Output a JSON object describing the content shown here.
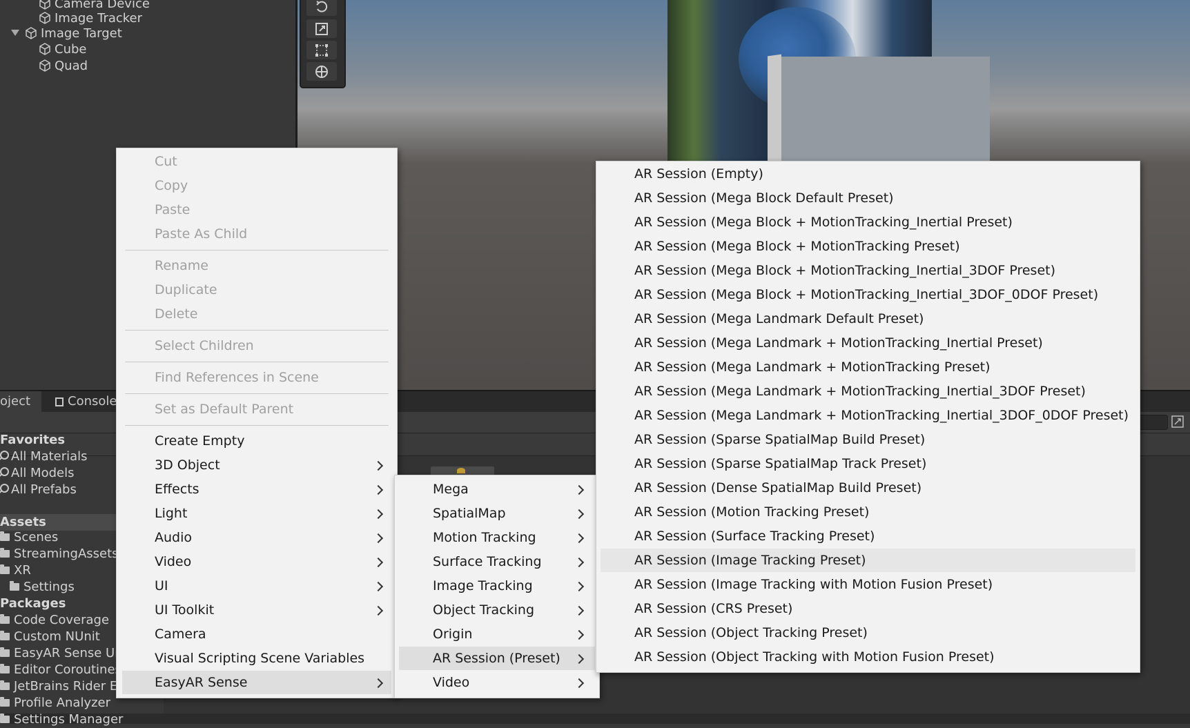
{
  "hierarchy": {
    "items": [
      {
        "label": "Camera Device"
      },
      {
        "label": "Image Tracker"
      },
      {
        "label": "Image Target"
      },
      {
        "label": "Cube"
      },
      {
        "label": "Quad"
      }
    ]
  },
  "bottom_panel": {
    "tabs": [
      {
        "label": "oject"
      },
      {
        "label": "Console"
      }
    ],
    "sidebar": {
      "favorites_header": "Favorites",
      "favorites": [
        {
          "label": "All Materials"
        },
        {
          "label": "All Models"
        },
        {
          "label": "All Prefabs"
        }
      ],
      "assets_header": "Assets",
      "assets": [
        {
          "label": "Scenes"
        },
        {
          "label": "StreamingAssets"
        },
        {
          "label": "XR"
        },
        {
          "label": "Settings"
        }
      ],
      "packages_header": "Packages",
      "packages": [
        {
          "label": "Code Coverage"
        },
        {
          "label": "Custom NUnit"
        },
        {
          "label": "EasyAR Sense Ur"
        },
        {
          "label": "Editor Coroutines"
        },
        {
          "label": "JetBrains Rider Ec"
        },
        {
          "label": "Profile Analyzer"
        },
        {
          "label": "Settings Manager"
        }
      ]
    }
  },
  "context_menu": {
    "items": [
      {
        "label": "Cut",
        "enabled": false
      },
      {
        "label": "Copy",
        "enabled": false
      },
      {
        "label": "Paste",
        "enabled": false
      },
      {
        "label": "Paste As Child",
        "enabled": false
      },
      {
        "label": "Rename",
        "enabled": false
      },
      {
        "label": "Duplicate",
        "enabled": false
      },
      {
        "label": "Delete",
        "enabled": false
      },
      {
        "label": "Select Children",
        "enabled": false
      },
      {
        "label": "Find References in Scene",
        "enabled": false
      },
      {
        "label": "Set as Default Parent",
        "enabled": false
      },
      {
        "label": "Create Empty",
        "enabled": true
      },
      {
        "label": "3D Object",
        "enabled": true,
        "submenu": true
      },
      {
        "label": "Effects",
        "enabled": true,
        "submenu": true
      },
      {
        "label": "Light",
        "enabled": true,
        "submenu": true
      },
      {
        "label": "Audio",
        "enabled": true,
        "submenu": true
      },
      {
        "label": "Video",
        "enabled": true,
        "submenu": true
      },
      {
        "label": "UI",
        "enabled": true,
        "submenu": true
      },
      {
        "label": "UI Toolkit",
        "enabled": true,
        "submenu": true
      },
      {
        "label": "Camera",
        "enabled": true
      },
      {
        "label": "Visual Scripting Scene Variables",
        "enabled": true
      },
      {
        "label": "EasyAR Sense",
        "enabled": true,
        "submenu": true,
        "highlighted": true
      }
    ]
  },
  "easyar_submenu": {
    "items": [
      {
        "label": "Mega"
      },
      {
        "label": "SpatialMap"
      },
      {
        "label": "Motion Tracking"
      },
      {
        "label": "Surface Tracking"
      },
      {
        "label": "Image Tracking"
      },
      {
        "label": "Object Tracking"
      },
      {
        "label": "Origin"
      },
      {
        "label": "AR Session (Preset)",
        "highlighted": true
      },
      {
        "label": "Video"
      }
    ]
  },
  "ar_session_submenu": {
    "items": [
      {
        "label": "AR Session (Empty)"
      },
      {
        "label": "AR Session (Mega Block Default Preset)"
      },
      {
        "label": "AR Session (Mega Block + MotionTracking_Inertial Preset)"
      },
      {
        "label": "AR Session (Mega Block + MotionTracking Preset)"
      },
      {
        "label": "AR Session (Mega Block + MotionTracking_Inertial_3DOF Preset)"
      },
      {
        "label": "AR Session (Mega Block + MotionTracking_Inertial_3DOF_0DOF Preset)"
      },
      {
        "label": "AR Session (Mega Landmark Default Preset)"
      },
      {
        "label": "AR Session (Mega Landmark + MotionTracking_Inertial Preset)"
      },
      {
        "label": "AR Session (Mega Landmark + MotionTracking Preset)"
      },
      {
        "label": "AR Session (Mega Landmark + MotionTracking_Inertial_3DOF Preset)"
      },
      {
        "label": "AR Session (Mega Landmark + MotionTracking_Inertial_3DOF_0DOF Preset)"
      },
      {
        "label": "AR Session (Sparse SpatialMap Build Preset)"
      },
      {
        "label": "AR Session (Sparse SpatialMap Track Preset)"
      },
      {
        "label": "AR Session (Dense SpatialMap Build Preset)"
      },
      {
        "label": "AR Session (Motion Tracking Preset)"
      },
      {
        "label": "AR Session (Surface Tracking Preset)"
      },
      {
        "label": "AR Session (Image Tracking Preset)",
        "highlighted": true
      },
      {
        "label": "AR Session (Image Tracking with Motion Fusion Preset)"
      },
      {
        "label": "AR Session (CRS Preset)"
      },
      {
        "label": "AR Session (Object Tracking Preset)"
      },
      {
        "label": "AR Session (Object Tracking with Motion Fusion Preset)"
      }
    ]
  }
}
